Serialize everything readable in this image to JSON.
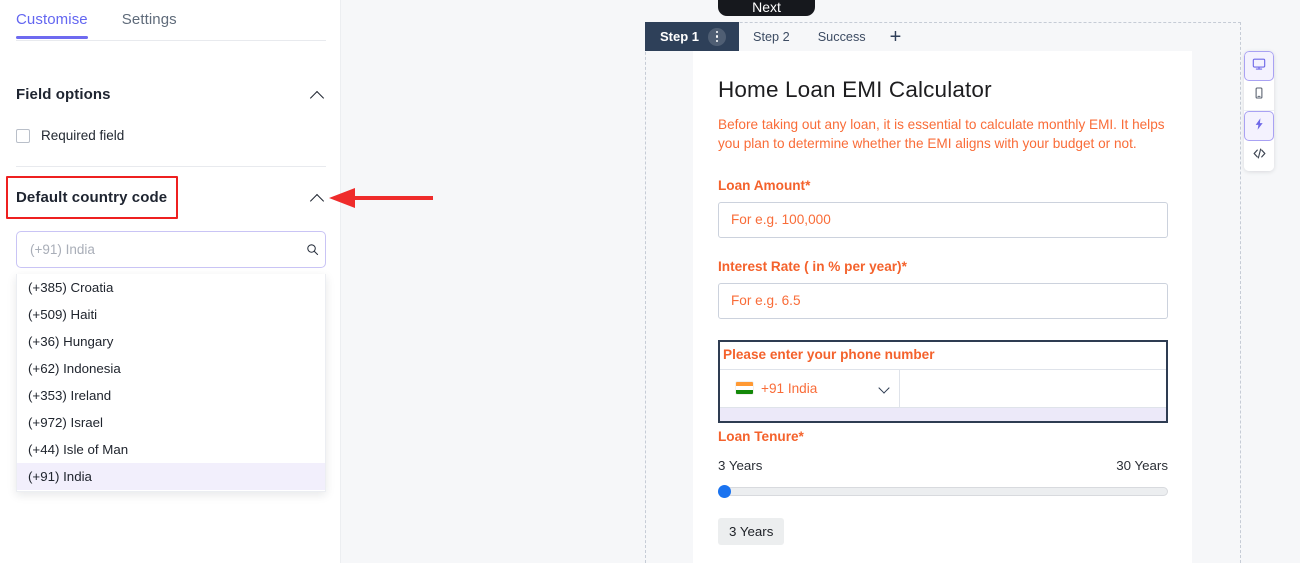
{
  "sidebar": {
    "tabs": [
      {
        "label": "Customise",
        "active": true
      },
      {
        "label": "Settings",
        "active": false
      }
    ],
    "field_options": {
      "title": "Field options",
      "chevron": "chevron-up-icon",
      "required_field_label": "Required field",
      "required_field_checked": false
    },
    "default_country_code": {
      "title": "Default country code",
      "chevron": "chevron-up-icon",
      "search_placeholder": "(+91) India",
      "search_value": "",
      "search_icon": "search-icon",
      "options": [
        {
          "label": "(+385) Croatia",
          "selected": false
        },
        {
          "label": "(+509) Haiti",
          "selected": false
        },
        {
          "label": "(+36) Hungary",
          "selected": false
        },
        {
          "label": "(+62) Indonesia",
          "selected": false
        },
        {
          "label": "(+353) Ireland",
          "selected": false
        },
        {
          "label": "(+972) Israel",
          "selected": false
        },
        {
          "label": "(+44) Isle of Man",
          "selected": false
        },
        {
          "label": "(+91) India",
          "selected": true
        }
      ]
    }
  },
  "canvas": {
    "next_button_label": "Next",
    "steps": [
      {
        "label": "Step 1",
        "active": true,
        "menu_icon": "kebab-menu-icon"
      },
      {
        "label": "Step 2",
        "active": false
      },
      {
        "label": "Success",
        "active": false
      }
    ],
    "add_step_label": "+"
  },
  "form": {
    "title": "Home Loan EMI Calculator",
    "description": "Before taking out any loan, it is essential to calculate monthly EMI. It helps you plan to determine whether the EMI aligns with your budget or not.",
    "fields": [
      {
        "label": "Loan Amount*",
        "placeholder": "For e.g. 100,000",
        "value": ""
      },
      {
        "label": "Interest Rate ( in % per year)*",
        "placeholder": "For e.g. 6.5",
        "value": ""
      }
    ],
    "phone": {
      "label": "Please enter your phone number",
      "country_flag": "india-flag-icon",
      "country_code": "+91 India",
      "chevron": "chevron-down-icon",
      "number_value": "",
      "selected": true
    },
    "tenure": {
      "label": "Loan Tenure*",
      "min_label": "3 Years",
      "max_label": "30 Years",
      "value_label": "3 Years",
      "min": 3,
      "max": 30,
      "value": 3
    }
  },
  "device_toolbar": {
    "buttons": [
      {
        "icon": "desktop-icon",
        "active": true
      },
      {
        "icon": "mobile-icon",
        "active": false
      },
      {
        "icon": "lightning-bolt-icon",
        "active": true
      },
      {
        "icon": "code-icon",
        "active": false
      }
    ]
  },
  "annotation": {
    "arrow_color": "#ef2b2b",
    "highlight_color": "#ee2020"
  },
  "colors": {
    "accent_purple": "#6366f1",
    "form_orange": "#f4622c",
    "step_navy": "#2e4059",
    "slider_blue": "#1a73f0"
  }
}
